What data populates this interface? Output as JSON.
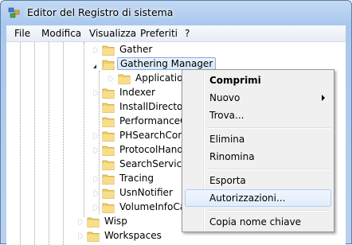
{
  "window": {
    "title": "Editor del Registro di sistema"
  },
  "menubar": {
    "items": [
      "File",
      "Modifica",
      "Visualizza",
      "Preferiti",
      "?"
    ]
  },
  "tree": {
    "rows": [
      {
        "label": "Gather"
      },
      {
        "label": "Gathering Manager"
      },
      {
        "label": "Application"
      },
      {
        "label": "Indexer"
      },
      {
        "label": "InstallDirectory"
      },
      {
        "label": "PerformanceC"
      },
      {
        "label": "PHSearchConn"
      },
      {
        "label": "ProtocolHandl"
      },
      {
        "label": "SearchService"
      },
      {
        "label": "Tracing"
      },
      {
        "label": "UsnNotifier"
      },
      {
        "label": "VolumeInfoCa"
      },
      {
        "label": "Wisp"
      },
      {
        "label": "Workspaces"
      }
    ]
  },
  "context_menu": {
    "items": {
      "comprimi": "Comprimi",
      "nuovo": "Nuovo",
      "trova": "Trova...",
      "elimina": "Elimina",
      "rinomina": "Rinomina",
      "esporta": "Esporta",
      "autorizzazioni": "Autorizzazioni...",
      "copia": "Copia nome chiave"
    }
  }
}
